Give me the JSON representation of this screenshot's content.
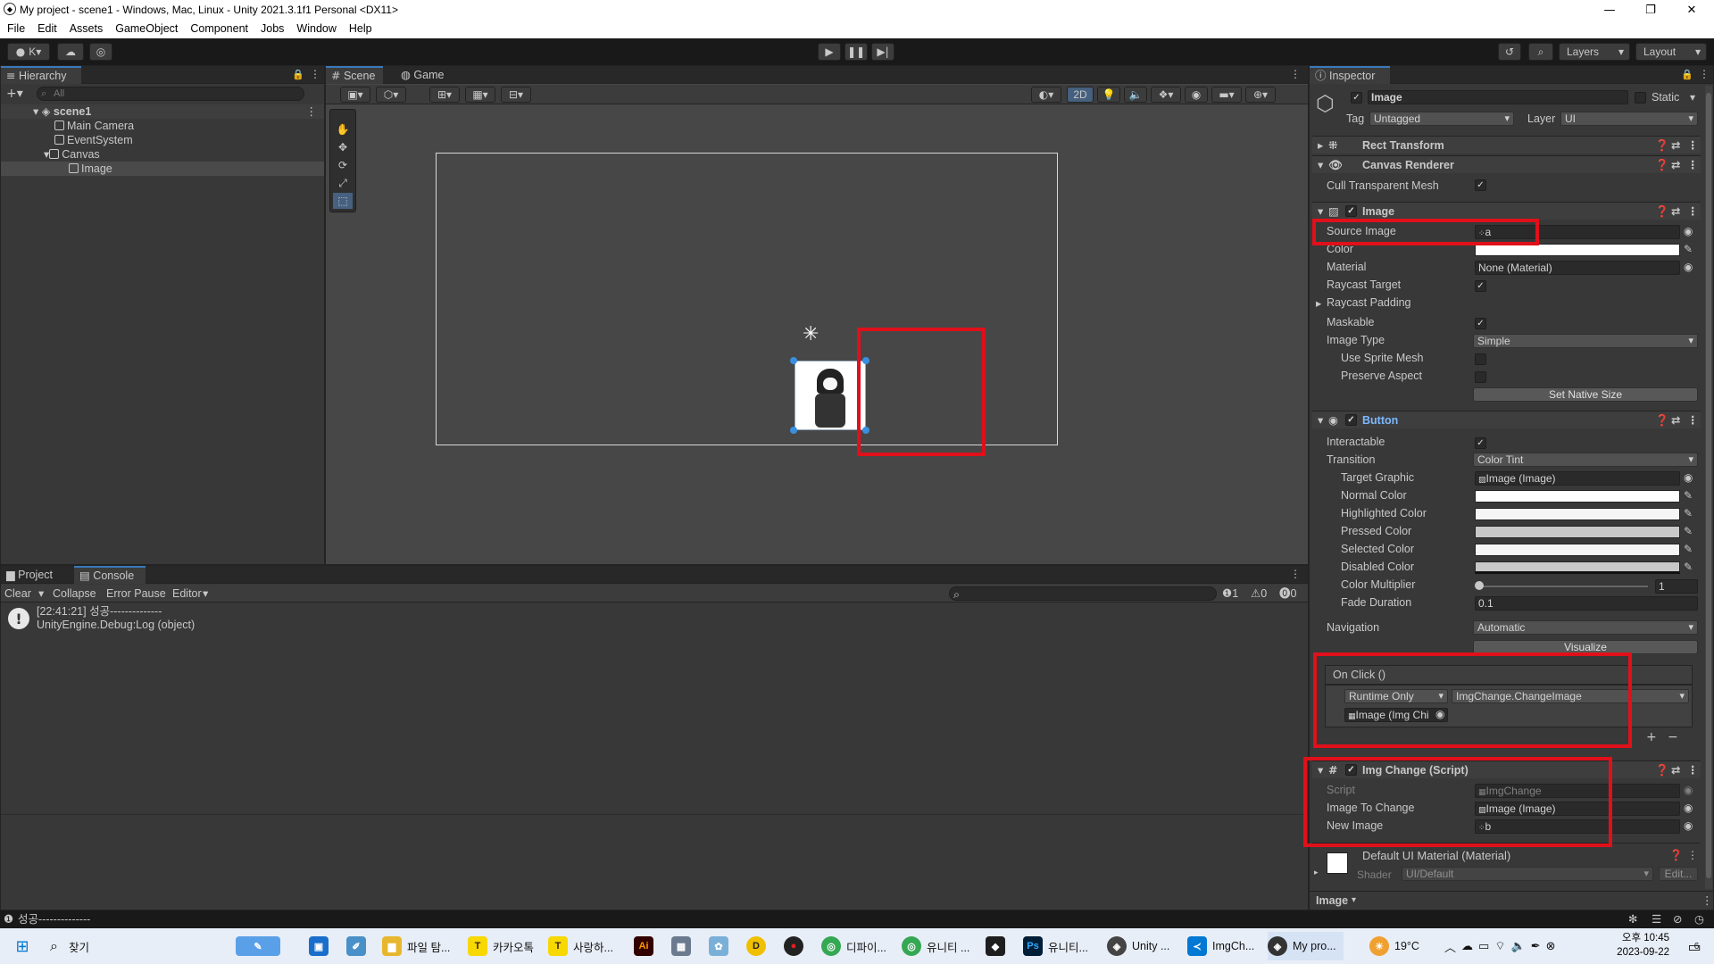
{
  "window": {
    "title": "My project - scene1 - Windows, Mac, Linux - Unity 2021.3.1f1 Personal <DX11>"
  },
  "menu": [
    "File",
    "Edit",
    "Assets",
    "GameObject",
    "Component",
    "Jobs",
    "Window",
    "Help"
  ],
  "toolbar": {
    "account": "K",
    "layers": "Layers",
    "layout": "Layout"
  },
  "hierarchy": {
    "tab": "Hierarchy",
    "search_placeholder": "All",
    "items": [
      {
        "label": "scene1"
      },
      {
        "label": "Main Camera"
      },
      {
        "label": "EventSystem"
      },
      {
        "label": "Canvas"
      },
      {
        "label": "Image"
      }
    ]
  },
  "scene": {
    "tabs": [
      "Scene",
      "Game"
    ],
    "mode2d": "2D"
  },
  "bottom": {
    "tabs": [
      "Project",
      "Console"
    ],
    "buttons": {
      "clear": "Clear",
      "collapse": "Collapse",
      "error_pause": "Error Pause",
      "editor": "Editor"
    },
    "counts": {
      "info": "1",
      "warn": "0",
      "error": "0"
    },
    "log": {
      "line1": "[22:41:21] 성공--------------",
      "line2": "UnityEngine.Debug:Log (object)"
    }
  },
  "inspector": {
    "tab": "Inspector",
    "object_name": "Image",
    "static_label": "Static",
    "tag_label": "Tag",
    "tag_value": "Untagged",
    "layer_label": "Layer",
    "layer_value": "UI",
    "rect_transform": "Rect Transform",
    "canvas_renderer": "Canvas Renderer",
    "cull_transparent": "Cull Transparent Mesh",
    "image": {
      "title": "Image",
      "source_image_label": "Source Image",
      "source_image_value": "a",
      "color_label": "Color",
      "material_label": "Material",
      "material_value": "None (Material)",
      "raycast_target": "Raycast Target",
      "raycast_padding": "Raycast Padding",
      "maskable": "Maskable",
      "image_type_label": "Image Type",
      "image_type_value": "Simple",
      "use_sprite_mesh": "Use Sprite Mesh",
      "preserve_aspect": "Preserve Aspect",
      "set_native_size": "Set Native Size"
    },
    "button": {
      "title": "Button",
      "interactable": "Interactable",
      "transition_label": "Transition",
      "transition_value": "Color Tint",
      "target_graphic_label": "Target Graphic",
      "target_graphic_value": "Image (Image)",
      "normal_color": "Normal Color",
      "highlighted_color": "Highlighted Color",
      "pressed_color": "Pressed Color",
      "selected_color": "Selected Color",
      "disabled_color": "Disabled Color",
      "color_multiplier_label": "Color Multiplier",
      "color_multiplier_value": "1",
      "fade_duration_label": "Fade Duration",
      "fade_duration_value": "0.1",
      "navigation_label": "Navigation",
      "navigation_value": "Automatic",
      "visualize": "Visualize",
      "onclick_title": "On Click ()",
      "runtime": "Runtime Only",
      "function": "ImgChange.ChangeImage",
      "object": "Image (Img Chi"
    },
    "img_change": {
      "title": "Img Change (Script)",
      "script_label": "Script",
      "script_value": "ImgChange",
      "image_to_change_label": "Image To Change",
      "image_to_change_value": "Image (Image)",
      "new_image_label": "New Image",
      "new_image_value": "b"
    },
    "material": {
      "title": "Default UI Material (Material)",
      "shader_label": "Shader",
      "shader_value": "UI/Default",
      "edit": "Edit..."
    },
    "footer": "Image"
  },
  "status": {
    "text": "성공--------------"
  },
  "taskbar": {
    "search": "찾기",
    "items": [
      {
        "label": "파일 탐..."
      },
      {
        "label": "카카오톡"
      },
      {
        "label": "사랑하..."
      },
      {
        "label": "디파이..."
      },
      {
        "label": "유니티 ..."
      },
      {
        "label": "유니티..."
      },
      {
        "label": "Unity ..."
      },
      {
        "label": "ImgCh..."
      },
      {
        "label": "My pro..."
      }
    ],
    "weather": "19°C",
    "time": "오후 10:45",
    "date": "2023-09-22",
    "notif": "6"
  },
  "colors": {
    "accent": "#3a79bb",
    "highlight": "#e0101a",
    "button_title": "#7cb8ff"
  }
}
